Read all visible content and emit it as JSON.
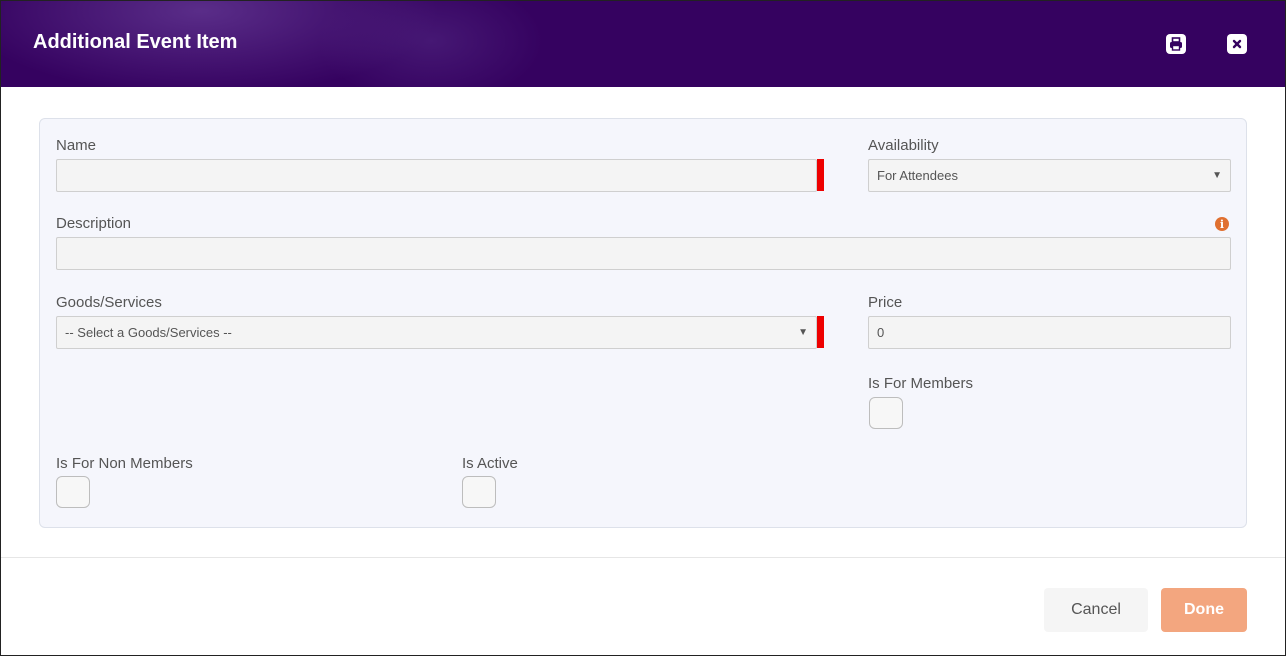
{
  "dialog": {
    "title": "Additional Event Item",
    "print_icon": "print-icon",
    "close_icon": "close-icon"
  },
  "form": {
    "name": {
      "label": "Name",
      "value": "",
      "required": true
    },
    "availability": {
      "label": "Availability",
      "selected": "For Attendees"
    },
    "description": {
      "label": "Description",
      "value": "",
      "info_icon": "info-icon"
    },
    "goods_services": {
      "label": "Goods/Services",
      "selected": "-- Select a Goods/Services --",
      "required": true
    },
    "price": {
      "label": "Price",
      "value": "0"
    },
    "is_for_members": {
      "label": "Is For Members",
      "checked": false
    },
    "is_for_non_members": {
      "label": "Is For Non Members",
      "checked": false
    },
    "is_active": {
      "label": "Is Active",
      "checked": false
    }
  },
  "footer": {
    "cancel_label": "Cancel",
    "done_label": "Done"
  },
  "colors": {
    "header_bg": "#350260",
    "required_marker": "#ee0000",
    "done_button": "#f3a67f",
    "info_icon": "#e07030"
  }
}
